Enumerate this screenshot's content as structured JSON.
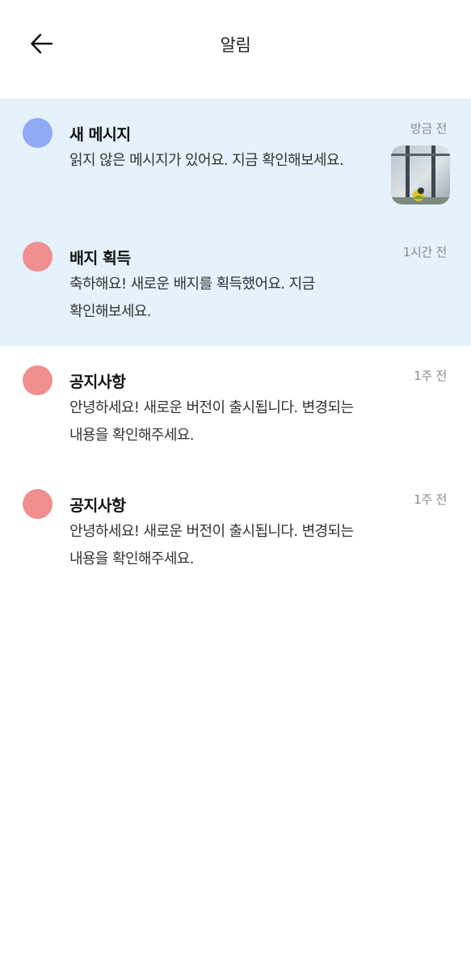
{
  "header": {
    "title": "알림",
    "back_icon": "arrow-left-icon"
  },
  "colors": {
    "unread_bg": "#e5f1fd",
    "message_dot": "#8fa9f5",
    "badge_dot": "#ef8f8f",
    "notice_dot": "#ef8f8f"
  },
  "notifications": [
    {
      "title": "새 메시지",
      "body": "읽지 않은 메시지가 있어요. 지금 확인해보세요.",
      "time": "방금 전",
      "unread": true,
      "has_thumbnail": true
    },
    {
      "title": "배지 획득",
      "body": "축하해요! 새로운 배지를 획득했어요. 지금 확인해보세요.",
      "time": "1시간 전",
      "unread": true,
      "has_thumbnail": false
    },
    {
      "title": "공지사항",
      "body": "안녕하세요! 새로운 버전이 출시됩니다. 변경되는 내용을 확인해주세요.",
      "time": "1주 전",
      "unread": false,
      "has_thumbnail": false
    },
    {
      "title": "공지사항",
      "body": "안녕하세요! 새로운 버전이 출시됩니다. 변경되는 내용을 확인해주세요.",
      "time": "1주 전",
      "unread": false,
      "has_thumbnail": false
    }
  ]
}
